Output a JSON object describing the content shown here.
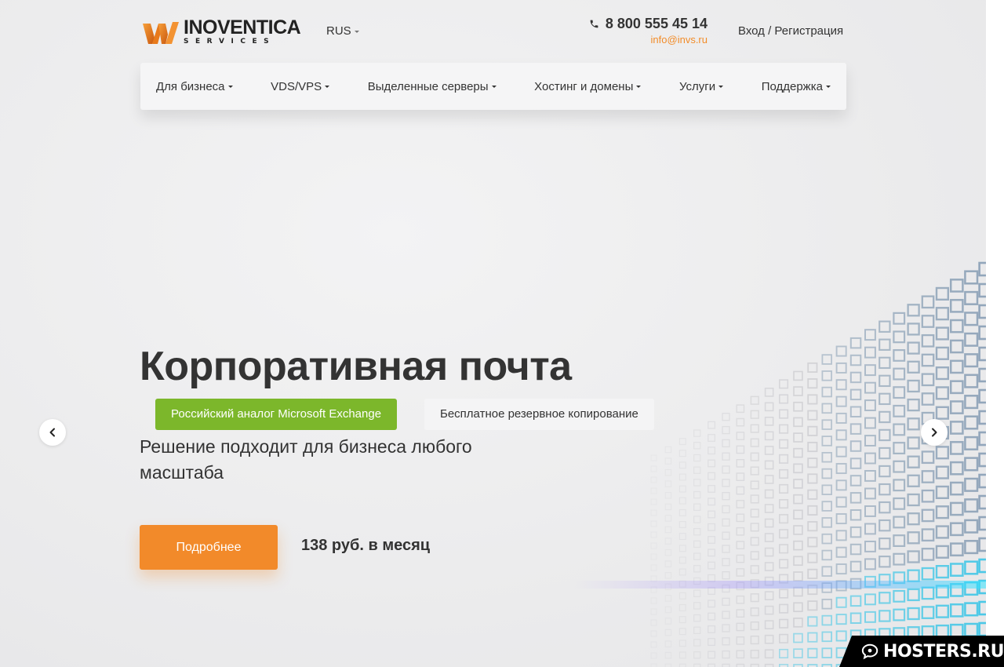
{
  "brand": {
    "name": "INOVENTICA",
    "subtitle": "SERVICES",
    "colors": {
      "accent": "#f28a2a",
      "green": "#7cb72b",
      "text": "#333333"
    }
  },
  "header": {
    "lang": "RUS",
    "phone": "8 800 555 45 14",
    "email": "info@invs.ru",
    "login": "Вход / Регистрация"
  },
  "nav": {
    "items": [
      {
        "label": "Для бизнеса"
      },
      {
        "label": "VDS/VPS"
      },
      {
        "label": "Выделенные серверы"
      },
      {
        "label": "Хостинг и домены"
      },
      {
        "label": "Услуги"
      },
      {
        "label": "Поддержка"
      }
    ]
  },
  "hero": {
    "title": "Корпоративная почта",
    "tag_primary": "Российский аналог Microsoft Exchange",
    "tag_secondary": "Бесплатное резервное копирование",
    "description": "Решение подходит для бизнеса любого масштаба",
    "button": "Подробнее",
    "price": "138 руб. в месяц"
  },
  "carousel": {
    "prev_icon": "chevron-left-icon",
    "next_icon": "chevron-right-icon"
  },
  "watermark": {
    "text": "HOSTERS.RU"
  }
}
